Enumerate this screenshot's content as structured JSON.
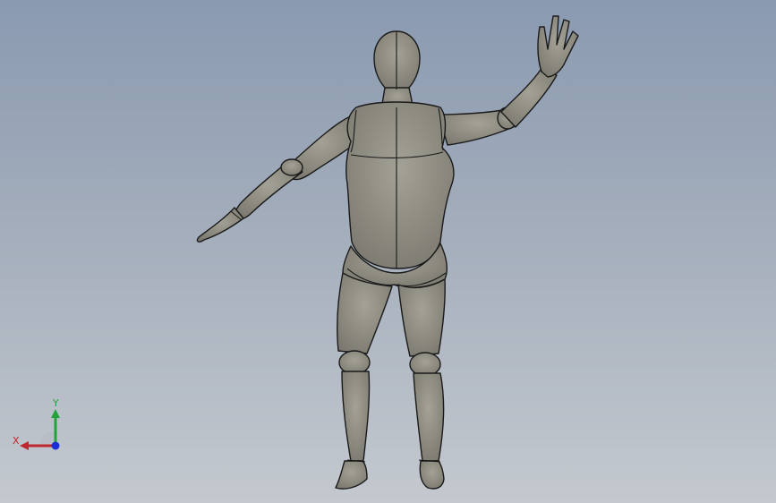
{
  "viewport": {
    "background_top": "#8a9ab0",
    "background_bottom": "#c4c9cf"
  },
  "model": {
    "icon": "mannequin-3d-model",
    "fill_color": "#8c8a80",
    "edge_color": "#1a1a1a"
  },
  "triad": {
    "x_label": "X",
    "y_label": "Y",
    "x_color": "#c0262d",
    "y_color": "#22a33a",
    "z_color": "#1c2fd6"
  }
}
